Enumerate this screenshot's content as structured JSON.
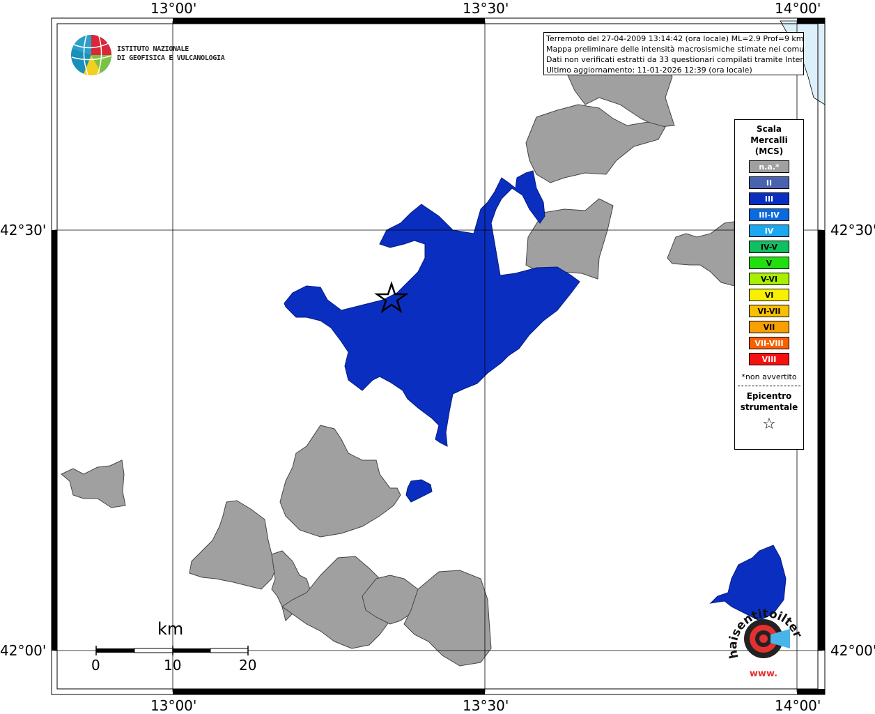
{
  "info_box": {
    "line1": "Terremoto del 27-04-2009 13:14:42 (ora locale) ML=2.9 Prof=9 km",
    "line2": "Mappa preliminare delle intensità macrosismiche stimate nei comuni",
    "line3": "Dati non verificati estratti da 33 questionari compilati tramite Internet.",
    "line4": "Ultimo aggiornamento: 11-01-2026 12:39 (ora locale)"
  },
  "institute": {
    "line1": "ISTITUTO NAZIONALE",
    "line2": "DI GEOFISICA E VULCANOLOGIA"
  },
  "axes": {
    "lon_ticks": [
      "13°00'",
      "13°30'",
      "14°00'"
    ],
    "lat_ticks": [
      "42°30'",
      "42°00'"
    ]
  },
  "scale_bar": {
    "unit": "km",
    "ticks": [
      "0",
      "10",
      "20"
    ]
  },
  "legend": {
    "title_line1": "Scala",
    "title_line2": "Mercalli",
    "title_line3": "(MCS)",
    "items": [
      {
        "label": "n.a.*",
        "color": "#a0a0a0"
      },
      {
        "label": "II",
        "color": "#4a63b0"
      },
      {
        "label": "III",
        "color": "#0a2fc0"
      },
      {
        "label": "III-IV",
        "color": "#0a6ae0"
      },
      {
        "label": "IV",
        "color": "#1aa8f0"
      },
      {
        "label": "IV-V",
        "color": "#10c060"
      },
      {
        "label": "V",
        "color": "#22e010"
      },
      {
        "label": "V-VI",
        "color": "#a8f000"
      },
      {
        "label": "VI",
        "color": "#f8f000"
      },
      {
        "label": "VI-VII",
        "color": "#f8c000"
      },
      {
        "label": "VII",
        "color": "#f8a000"
      },
      {
        "label": "VII-VIII",
        "color": "#f86000"
      },
      {
        "label": "VIII",
        "color": "#f81010"
      }
    ],
    "note": "*non avvertito",
    "epicenter_line1": "Epicentro",
    "epicenter_line2": "strumentale",
    "epicenter_symbol": "☆"
  },
  "logo_text": {
    "brand": "haisentitoilterremoto.it",
    "www": "www."
  },
  "colors": {
    "felt_iii": "#0a2fc0",
    "not_available": "#a0a0a0",
    "sea": "#dceffa"
  }
}
